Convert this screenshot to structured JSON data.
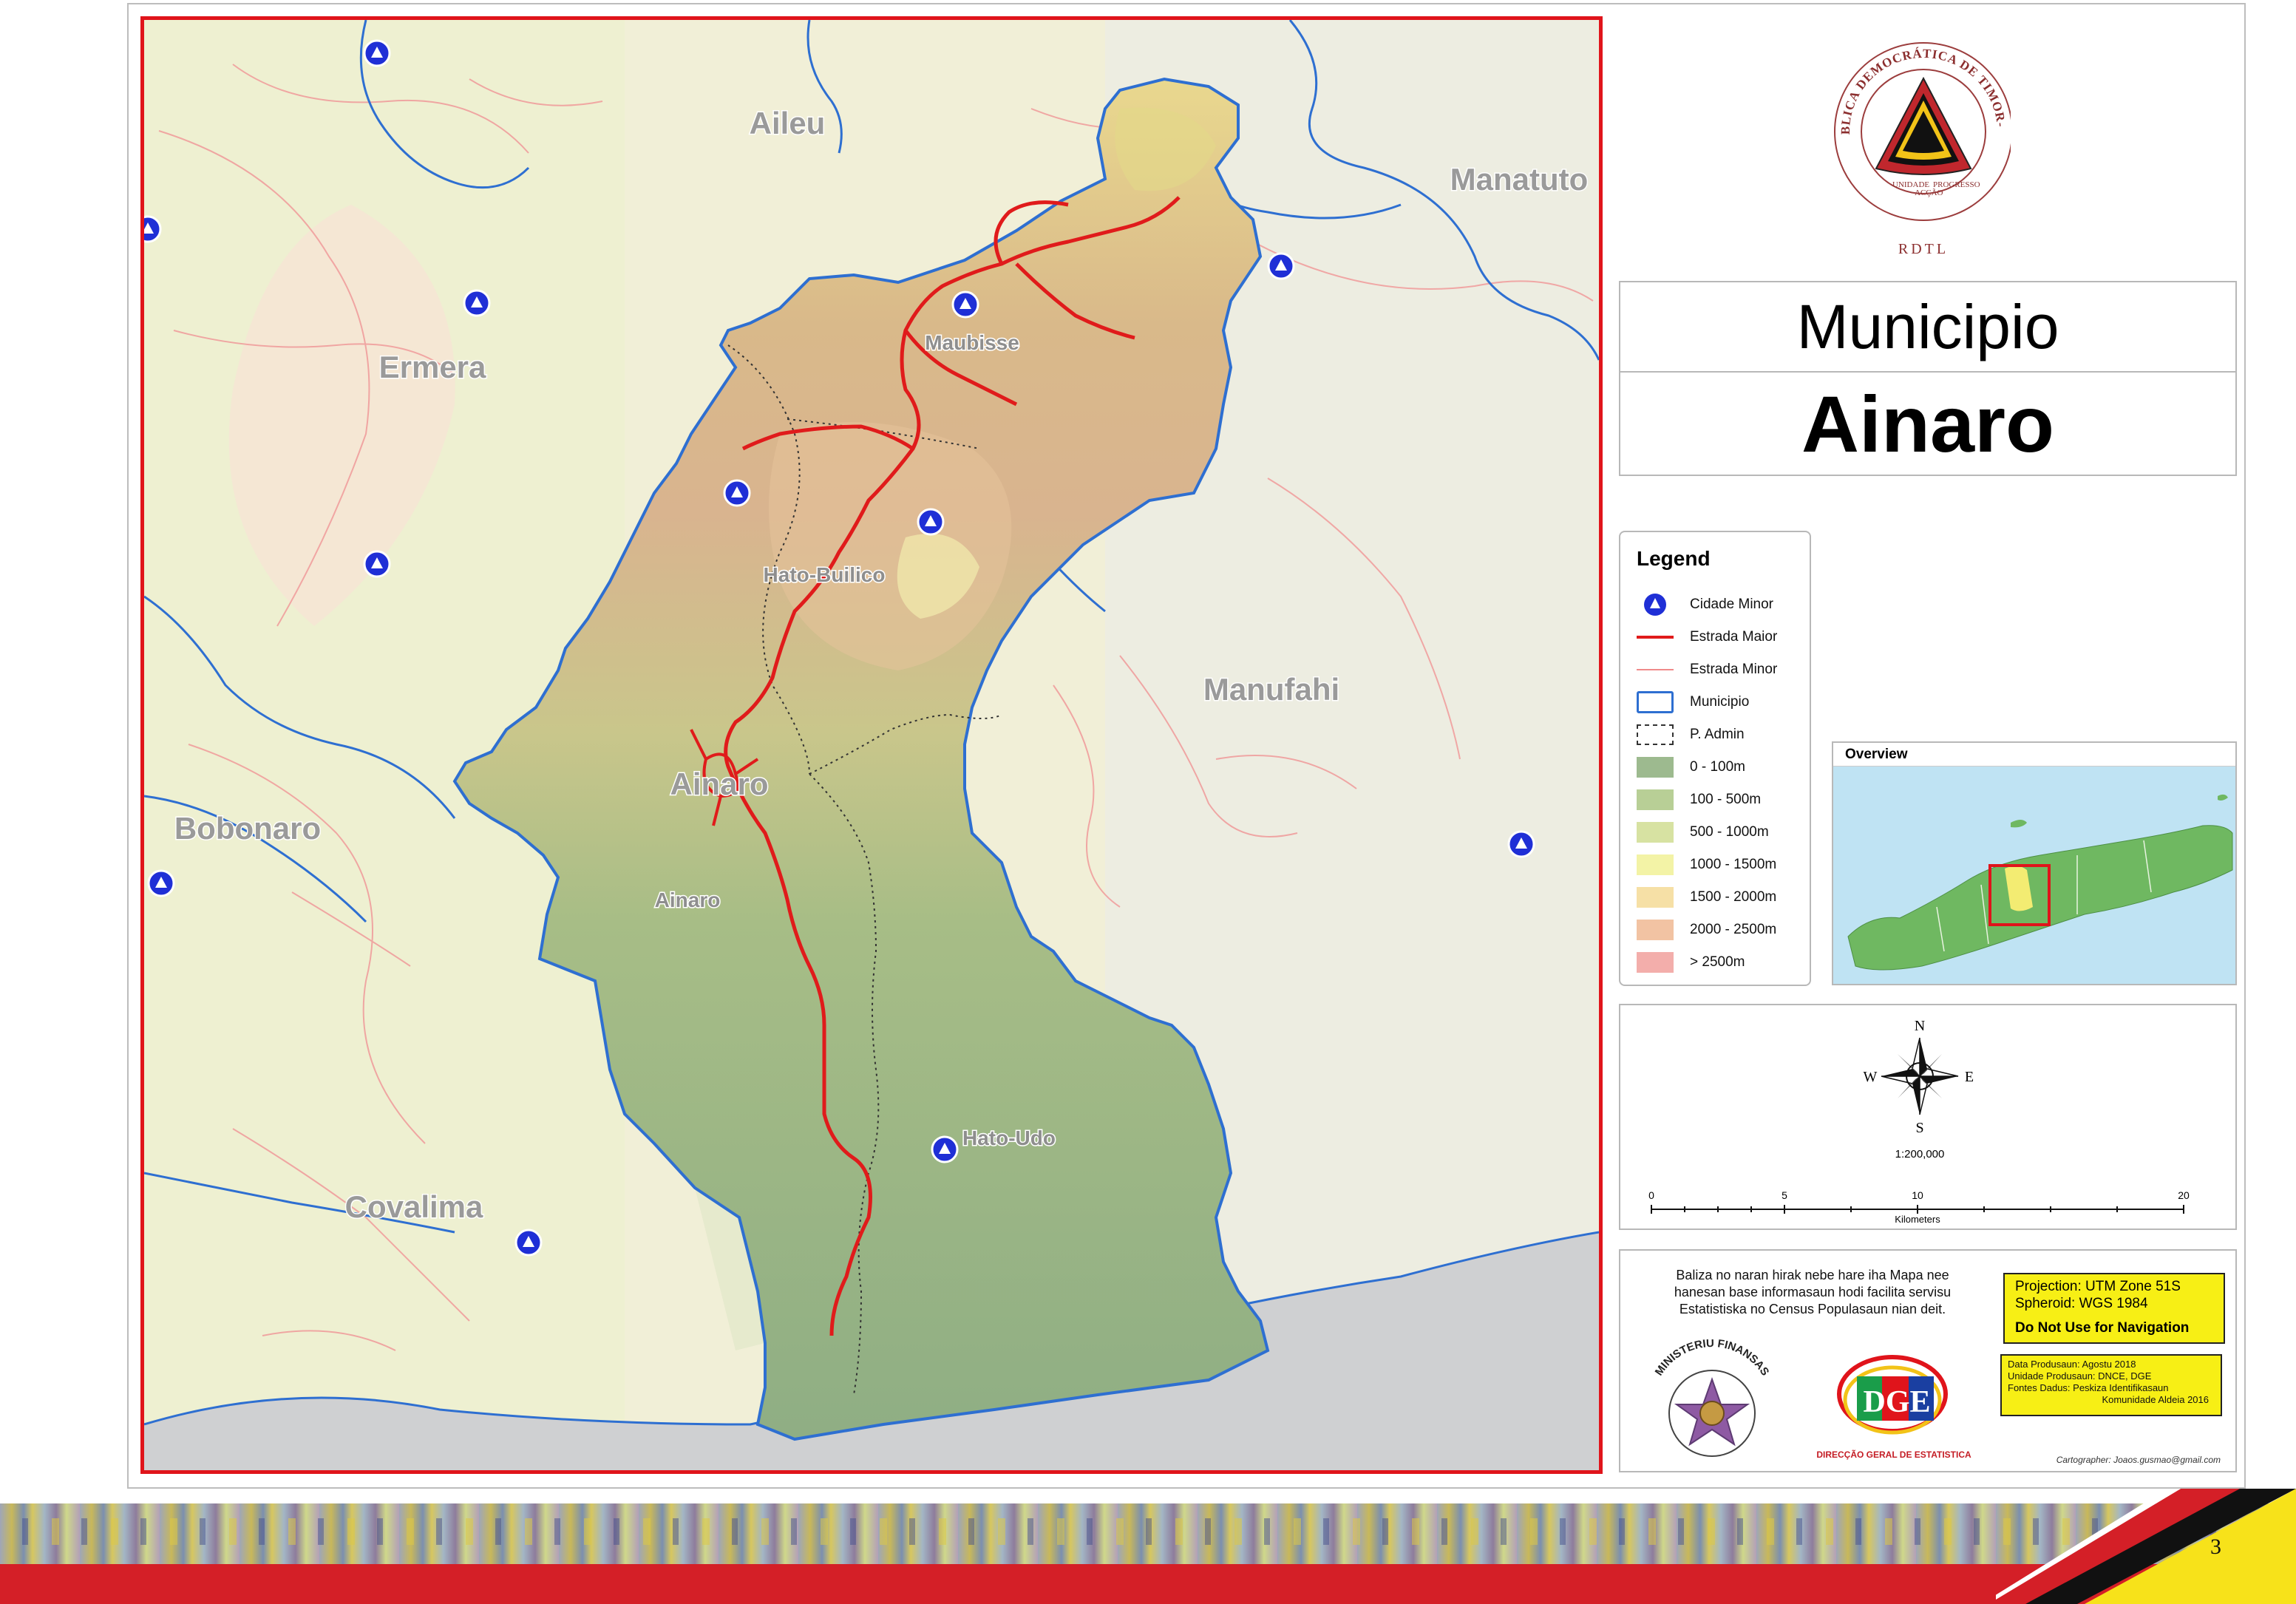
{
  "header": {
    "seal_text_top": "REPÚBLICA DEMOCRÁTICA DE TIMOR-LESTE",
    "seal_text_left": "UNIDADE",
    "seal_text_mid": "ACÇÃO",
    "seal_text_right": "PROGRESSO",
    "seal_text_bottom": "RDTL"
  },
  "title": {
    "kind": "Municipio",
    "name": "Ainaro"
  },
  "map": {
    "neighbors": [
      "Aileu",
      "Manatuto",
      "Ermera",
      "Manufahi",
      "Bobonaro",
      "Covalima"
    ],
    "center_label": "Ainaro",
    "posts": [
      "Maubisse",
      "Hato-Builico",
      "Ainaro",
      "Hato-Udo"
    ]
  },
  "legend": {
    "title": "Legend",
    "items": [
      {
        "label": "Cidade Minor",
        "symbol": "city-icon"
      },
      {
        "label": "Estrada Maior",
        "symbol": "major-road-line"
      },
      {
        "label": "Estrada Minor",
        "symbol": "minor-road-line"
      },
      {
        "label": "Municipio",
        "symbol": "municipio-boundary"
      },
      {
        "label": "P. Admin",
        "symbol": "post-boundary"
      },
      {
        "label": "0 - 100m",
        "color": "#9dba8f"
      },
      {
        "label": "100 - 500m",
        "color": "#b8cf96"
      },
      {
        "label": "500 - 1000m",
        "color": "#d7e2a2"
      },
      {
        "label": "1000 - 1500m",
        "color": "#f3f3a6"
      },
      {
        "label": "1500 - 2000m",
        "color": "#f6e0a6"
      },
      {
        "label": "2000 - 2500m",
        "color": "#f2c3a3"
      },
      {
        "label": "> 2500m",
        "color": "#f3aeab"
      }
    ]
  },
  "overview": {
    "title": "Overview"
  },
  "compass": {
    "n": "N",
    "s": "S",
    "e": "E",
    "w": "W"
  },
  "scale": {
    "ratio": "1:200,000",
    "ticks": [
      "0",
      "5",
      "10",
      "20"
    ],
    "unit": "Kilometers"
  },
  "info": {
    "disclaimer_lines": [
      "Baliza no naran hirak nebe hare iha Mapa nee",
      "hanesan base informasaun hodi facilita servisu",
      "Estatistiska no Census Populasaun nian deit."
    ],
    "projection": "Projection: UTM Zone 51S",
    "spheroid": "Spheroid: WGS 1984",
    "warning": "Do Not Use for Navigation",
    "production_date": "Data Produsaun: Agostu 2018",
    "production_unit": "Unidade Produsaun: DNCE, DGE",
    "sources_1": "Fontes Dadus: Peskiza Identifikasaun",
    "sources_2": "Komunidade Aldeia 2016",
    "ministry": "MINISTERIU FINANSAS",
    "dge": "DIRECÇÃO GERAL DE ESTATISTICA",
    "cartographer": "Cartographer: Joaos.gusmao@gmail.com"
  },
  "footer": {
    "page_number": "3"
  },
  "colors": {
    "frame_red": "#e0141b",
    "boundary_blue": "#2e6fd1",
    "major_road": "#e01b1b",
    "minor_road": "#f08a8a",
    "footer_red": "#d41f27",
    "footer_yellow": "#f7e21a"
  }
}
